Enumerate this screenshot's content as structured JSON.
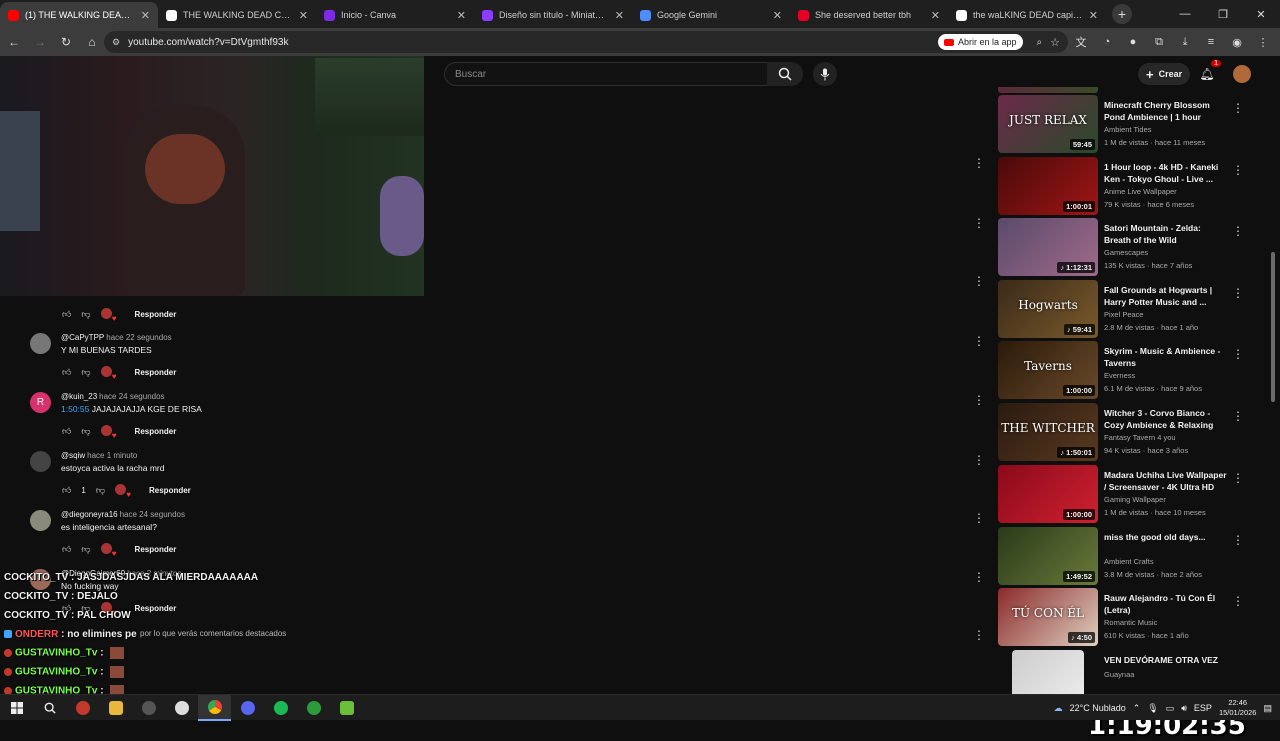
{
  "browser": {
    "tabs": [
      {
        "title": "(1) THE WALKING DEAD - CAP",
        "color": "#ff0000",
        "active": true
      },
      {
        "title": "THE WALKING DEAD CAPITULO",
        "color": "#ffffff",
        "active": false
      },
      {
        "title": "Inicio - Canva",
        "color": "#7d2ae8",
        "active": false
      },
      {
        "title": "Diseño sin título - Miniatura pa",
        "color": "#8b3dff",
        "active": false
      },
      {
        "title": "Google Gemini",
        "color": "#4e8cff",
        "active": false
      },
      {
        "title": "She deserved better tbh",
        "color": "#e60023",
        "active": false
      },
      {
        "title": "the waLKING DEAD capitulo 1",
        "color": "#ffffff",
        "active": false
      }
    ],
    "url": "youtube.com/watch?v=DtVgmthf93k",
    "open_in_app": "Abrir en la app"
  },
  "youtube": {
    "search_placeholder": "Buscar",
    "create_label": "Crear",
    "notif_count": "1"
  },
  "comments": {
    "reply_label": "Responder",
    "items": [
      {
        "user": "@CaPyTPP",
        "when": "hace 22 segundos",
        "text": "Y MI BUENAS TARDES",
        "avatar_color": "#777777"
      },
      {
        "user": "@kuin_23",
        "when": "hace 24 segundos",
        "timestamp": "1:50:55",
        "text": "JAJAJAJAJJA KGE DE RISA",
        "avatar_color": "#d6336c",
        "initial": "R"
      },
      {
        "user": "@sqiw",
        "when": "hace 1 minuto",
        "text": "estoyca activa la racha mrd",
        "avatar_color": "#444444",
        "likes": "1"
      },
      {
        "user": "@diegoneyra16",
        "when": "hace 24 segundos",
        "text": "es inteligencia artesanal?",
        "avatar_color": "#8a8a7a"
      },
      {
        "user": "@DiegoGaimer69",
        "when": "hace 2 minutos",
        "text": "No fucking way",
        "avatar_color": "#9a6a5a"
      }
    ],
    "featured_note": "por lo que verás comentarios destacados"
  },
  "stream_chat": [
    {
      "user": "COCKITO_TV",
      "msg": "JASJDASJDAS ALA MIERDAAAAAAA"
    },
    {
      "user": "COCKITO_TV",
      "msg": "DEJALO"
    },
    {
      "user": "COCKITO_TV",
      "msg": "PAL CHOW"
    },
    {
      "user": "ONDERR",
      "msg": "no elimines pe"
    },
    {
      "user": "GUSTAVINHO_Tv",
      "msg": ""
    },
    {
      "user": "GUSTAVINHO_Tv",
      "msg": ""
    },
    {
      "user": "GUSTAVINHO_Tv",
      "msg": ""
    }
  ],
  "recommendations": [
    {
      "title": "Minecraft Cherry Blossom Pond Ambience | 1 hour Minecraft ...",
      "channel": "Ambient Tides",
      "meta": "1 M de vistas · hace 11 meses",
      "duration": "59:45",
      "thumb_label": "JUST RELAX",
      "colors": [
        "#6b2a4a",
        "#2a4a2a"
      ]
    },
    {
      "title": "1 Hour loop - 4k HD - Kaneki Ken - Tokyo Ghoul - Live ...",
      "channel": "Anime Live Wallpaper",
      "meta": "79 K vistas · hace 6 meses",
      "duration": "1:00:01",
      "thumb_label": "",
      "colors": [
        "#4a0a0a",
        "#a01515"
      ]
    },
    {
      "title": "Satori Mountain - Zelda: Breath of the Wild",
      "channel": "Gamescapes",
      "meta": "135 K vistas · hace 7 años",
      "duration": "♪ 1:12:31",
      "thumb_label": "",
      "colors": [
        "#5a4a6a",
        "#a06a8a"
      ]
    },
    {
      "title": "Fall Grounds at Hogwarts | Harry Potter Music and ...",
      "channel": "Pixel Peace",
      "meta": "2.8 M de vistas · hace 1 año",
      "duration": "♪ 59:41",
      "thumb_label": "Hogwarts",
      "colors": [
        "#3a2a1a",
        "#7a5a2a"
      ]
    },
    {
      "title": "Skyrim - Music & Ambience - Taverns",
      "channel": "Everness",
      "meta": "6.1 M de vistas · hace 9 años",
      "duration": "1:00:00",
      "thumb_label": "Taverns",
      "colors": [
        "#2a1a0a",
        "#6a4a2a"
      ]
    },
    {
      "title": "Witcher 3 - Corvo Bianco - Cozy Ambience & Relaxing Music",
      "channel": "Fantasy Tavern 4 you",
      "meta": "94 K vistas · hace 3 años",
      "duration": "♪ 1:50:01",
      "thumb_label": "THE WITCHER",
      "colors": [
        "#2a1a10",
        "#5a3a20"
      ]
    },
    {
      "title": "Madara Uchiha Live Wallpaper / Screensaver - 4K Ultra HD",
      "channel": "Gaming Wallpaper",
      "meta": "1 M de vistas · hace 10 meses",
      "duration": "1:00:00",
      "thumb_label": "",
      "colors": [
        "#8a0a1a",
        "#d02030"
      ]
    },
    {
      "title": "miss the good old days...",
      "channel": "Ambient Crafts",
      "meta": "3.8 M de vistas · hace 2 años",
      "duration": "1:49:52",
      "thumb_label": "",
      "colors": [
        "#2a3a1a",
        "#6a7a3a"
      ]
    },
    {
      "title": "Rauw Alejandro - Tú Con Él (Letra)",
      "channel": "Romantic Music",
      "meta": "610 K vistas · hace 1 año",
      "duration": "♪ 4:50",
      "thumb_label": "TÚ CON ÉL",
      "colors": [
        "#8a2a2a",
        "#e0d0c0"
      ]
    },
    {
      "title": "VEN DEVÓRAME OTRA VEZ",
      "channel": "Guaynaa",
      "meta": "",
      "duration": "",
      "thumb_label": "",
      "colors": [
        "#cccccc",
        "#eeeeee"
      ]
    }
  ],
  "overlay_clock": "1:19:02:35",
  "taskbar": {
    "weather": "22°C  Nublado",
    "lang": "ESP",
    "time": "22:46",
    "date": "15/01/2026"
  }
}
